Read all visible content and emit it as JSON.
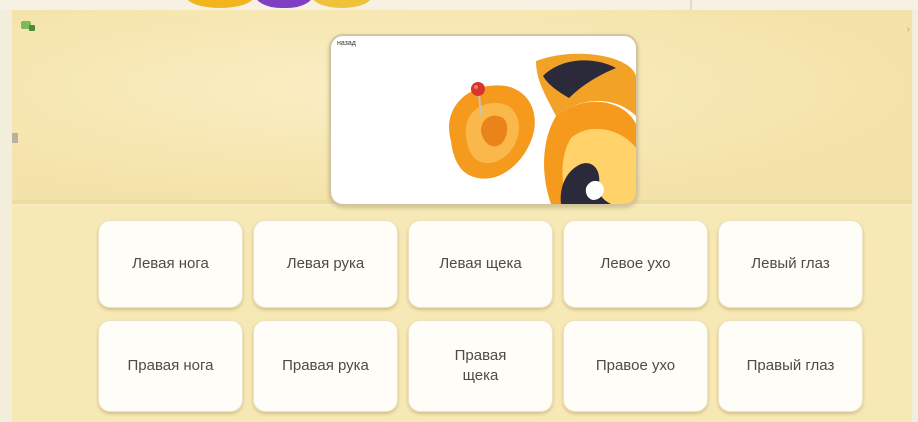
{
  "prompt_image": {
    "back_link": "назад",
    "subject": "ear-with-pin-illustration"
  },
  "answers": [
    {
      "label": "Левая нога"
    },
    {
      "label": "Левая рука"
    },
    {
      "label": "Левая щека"
    },
    {
      "label": "Левое ухо"
    },
    {
      "label": "Левый глаз"
    },
    {
      "label": "Правая нога"
    },
    {
      "label": "Правая рука"
    },
    {
      "label": "Правая щека"
    },
    {
      "label": "Правое ухо"
    },
    {
      "label": "Правый глаз"
    }
  ],
  "colors": {
    "board": "#f7e9b5",
    "tile": "#fffdf7",
    "tile_text": "#4b4b4b",
    "ear_orange": "#f59a1d",
    "ear_dark": "#2a2a3a",
    "pin_red": "#d9352b"
  },
  "icons": [
    "app-corner-icon"
  ]
}
